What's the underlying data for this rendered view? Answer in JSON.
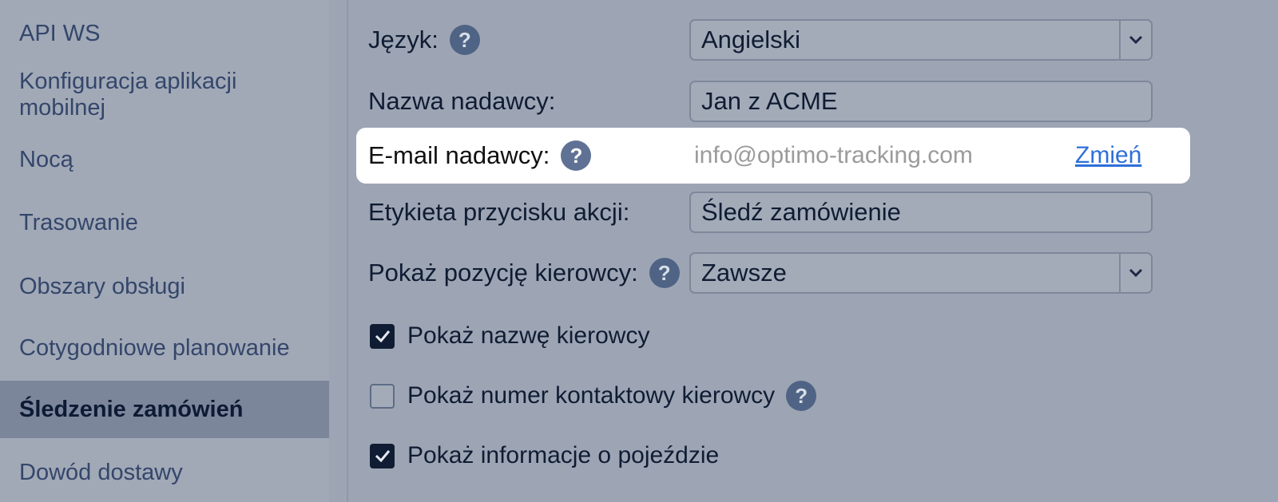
{
  "sidebar": {
    "items": [
      {
        "label": "API WS",
        "active": false
      },
      {
        "label": "Konfiguracja aplikacji mobilnej",
        "active": false
      },
      {
        "label": "Nocą",
        "active": false
      },
      {
        "label": "Trasowanie",
        "active": false
      },
      {
        "label": "Obszary obsługi",
        "active": false
      },
      {
        "label": "Cotygodniowe planowanie",
        "active": false
      },
      {
        "label": "Śledzenie zamówień",
        "active": true
      },
      {
        "label": "Dowód dostawy",
        "active": false
      }
    ]
  },
  "form": {
    "language": {
      "label": "Język:",
      "value": "Angielski",
      "help": "?"
    },
    "sender_name": {
      "label": "Nazwa nadawcy:",
      "value": "Jan z ACME"
    },
    "sender_email": {
      "label": "E-mail nadawcy:",
      "value": "info@optimo-tracking.com",
      "change_link": "Zmień",
      "help": "?"
    },
    "action_button_label": {
      "label": "Etykieta przycisku akcji:",
      "value": "Śledź zamówienie"
    },
    "driver_position": {
      "label": "Pokaż pozycję kierowcy:",
      "value": "Zawsze",
      "help": "?"
    },
    "checkboxes": [
      {
        "label": "Pokaż nazwę kierowcy",
        "checked": true
      },
      {
        "label": "Pokaż numer kontaktowy kierowcy",
        "checked": false,
        "help": "?"
      },
      {
        "label": "Pokaż informacje o pojeździe",
        "checked": true
      }
    ]
  },
  "icons": {
    "help": "question-mark-circle-icon",
    "dropdown": "chevron-down-icon",
    "check": "checkmark-icon"
  },
  "colors": {
    "highlight_bg": "#ffffff",
    "link": "#2d6fd8",
    "active_sidebar": "#7b869b"
  }
}
